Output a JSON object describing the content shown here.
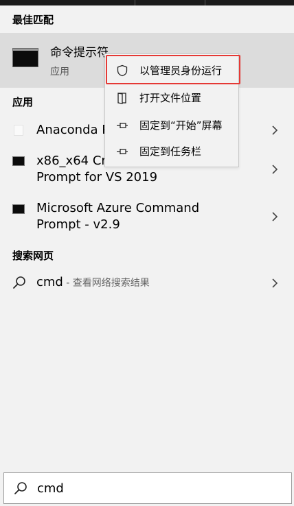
{
  "sections": {
    "best_match": "最佳匹配",
    "apps": "应用",
    "search_web": "搜索网页"
  },
  "best_match": {
    "title": "命令提示符",
    "subtitle": "应用",
    "icon": "cmd-icon"
  },
  "context_menu": {
    "items": [
      {
        "label": "以管理员身份运行",
        "icon": "shield-icon"
      },
      {
        "label": "打开文件位置",
        "icon": "folder-open-icon"
      },
      {
        "label": "固定到“开始”屏幕",
        "icon": "pin-icon"
      },
      {
        "label": "固定到任务栏",
        "icon": "pin-icon"
      }
    ],
    "highlight_color": "#e53935"
  },
  "apps": [
    {
      "line1": "Anaconda P",
      "line2": "",
      "icon": "anaconda-icon"
    },
    {
      "line1": "x86_x64 Cro",
      "line2": "Prompt for VS 2019",
      "icon": "cmd-icon"
    },
    {
      "line1": "Microsoft Azure Command",
      "line2": "Prompt - v2.9",
      "icon": "cmd-icon"
    }
  ],
  "web": {
    "query": "cmd",
    "suffix": " - 查看网络搜索结果",
    "icon": "search-icon"
  },
  "searchbox": {
    "value": "cmd",
    "icon": "search-icon"
  }
}
